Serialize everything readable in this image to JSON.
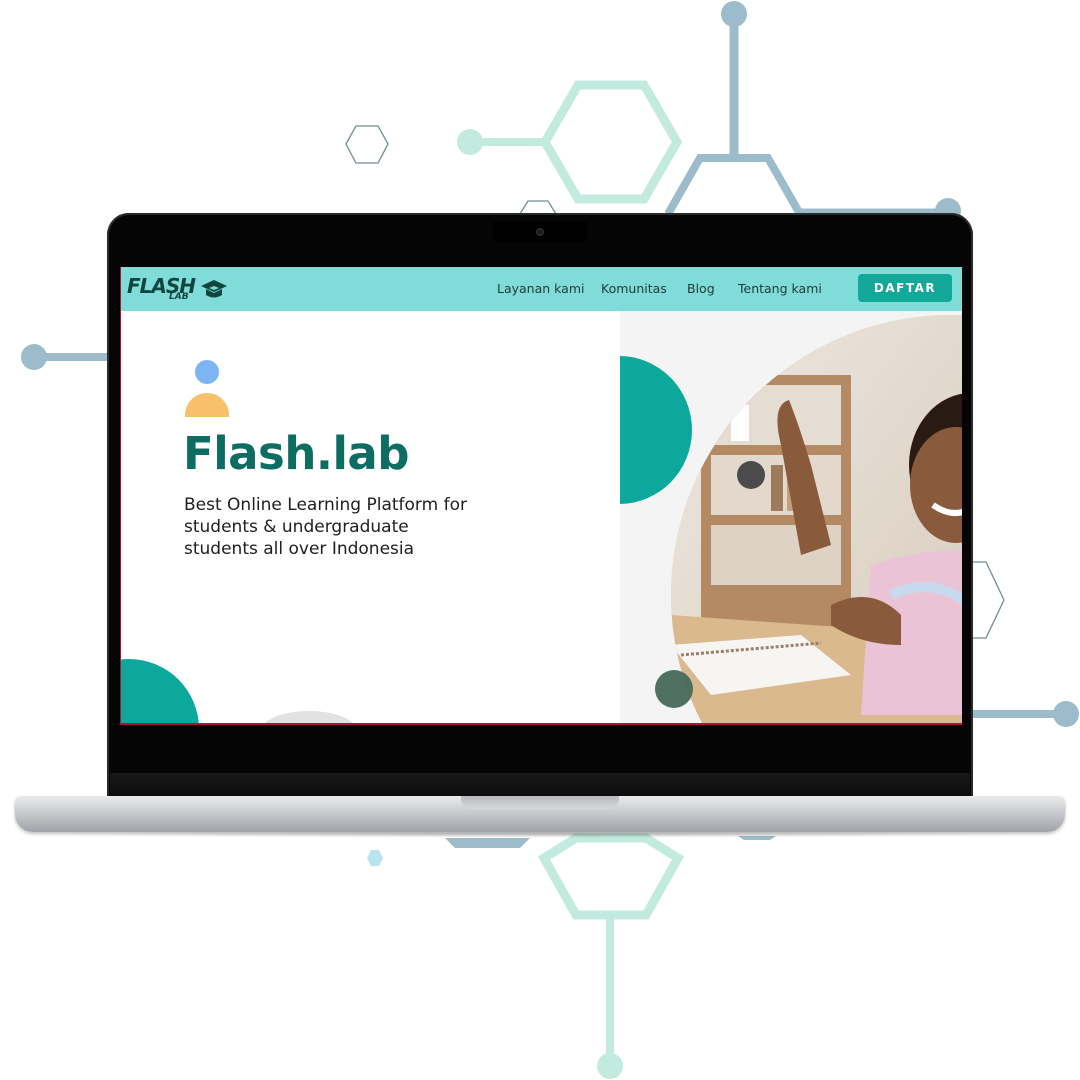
{
  "colors": {
    "nav_bg": "#80dcd8",
    "brand_teal": "#0ba89b",
    "title_teal": "#0e6d62",
    "button_bg": "#14a89a",
    "avatar_head": "#7bb6f2",
    "avatar_body": "#f8c06a",
    "deco_green": "#c3eadf",
    "deco_blue": "#9dbccb"
  },
  "nav": {
    "logo_main": "FLASH",
    "logo_sub": "LAB",
    "links": [
      "Layanan kami",
      "Komunitas",
      "Blog",
      "Tentang kami"
    ],
    "cta": "DAFTAR"
  },
  "hero": {
    "title": "Flash.lab",
    "tagline_lines": [
      "Best Online Learning Platform for",
      "students & undergraduate",
      "students all over Indonesia"
    ],
    "icon": "user-icon"
  },
  "icons": [
    "graduation-cap-icon",
    "user-icon"
  ]
}
